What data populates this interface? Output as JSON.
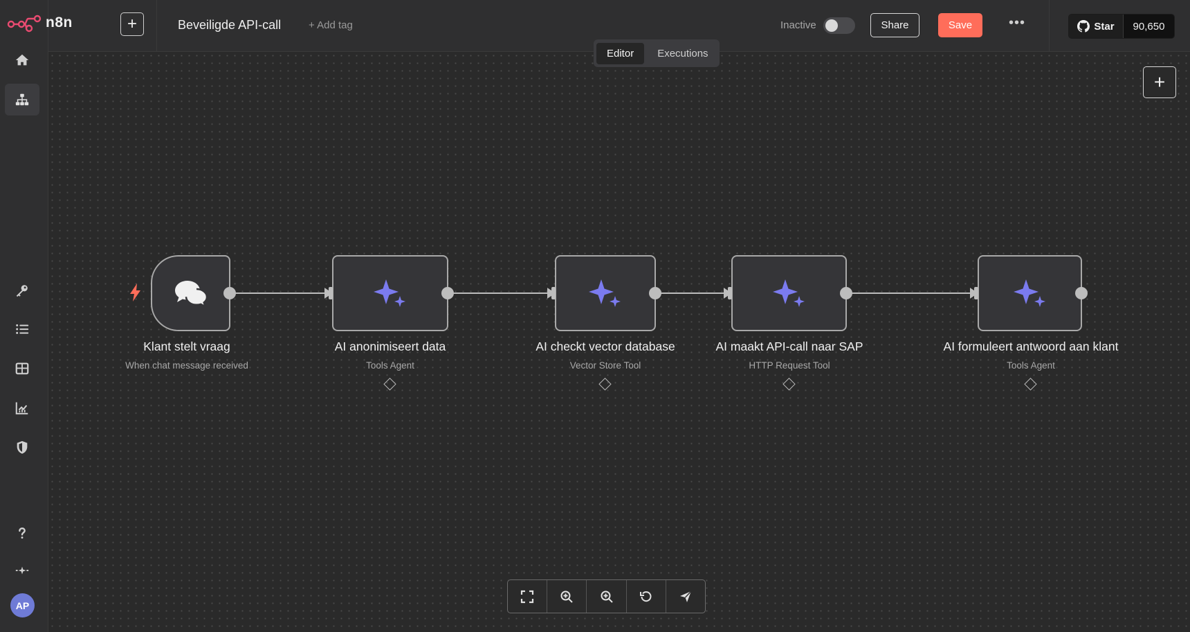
{
  "app": {
    "brand": "n8n",
    "brand_color": "#ea4b71"
  },
  "header": {
    "new_button_label": "+",
    "workflow_title": "Beveiligde API-call",
    "add_tag_label": "+ Add tag",
    "active_label": "Inactive",
    "active": false,
    "share_label": "Share",
    "save_label": "Save",
    "save_color": "#ff6d5a",
    "more_label": "•••",
    "github": {
      "star_label": "Star",
      "star_count": "90,650"
    }
  },
  "tabs": [
    {
      "label": "Editor",
      "active": true
    },
    {
      "label": "Executions",
      "active": false
    }
  ],
  "sidebar": {
    "items": [
      {
        "icon": "home-icon"
      },
      {
        "icon": "workflow-icon",
        "active": true
      },
      {
        "icon": "key-icon"
      },
      {
        "icon": "list-icon"
      },
      {
        "icon": "table-icon"
      },
      {
        "icon": "chart-icon"
      },
      {
        "icon": "shield-icon"
      },
      {
        "icon": "help-icon"
      },
      {
        "icon": "sparkle-icon"
      }
    ],
    "avatar_initials": "AP"
  },
  "canvas": {
    "add_node_label": "+",
    "nodes": [
      {
        "id": "trigger",
        "title": "Klant stelt vraag",
        "subtitle": "When chat message received",
        "icon": "chat-icon",
        "trigger_icon": "lightning-icon"
      },
      {
        "id": "anon",
        "title": "AI anonimiseert data",
        "subtitle": "Tools Agent",
        "icon": "sparkles-icon"
      },
      {
        "id": "vector",
        "title": "AI checkt vector database",
        "subtitle": "Vector Store Tool",
        "icon": "sparkles-icon"
      },
      {
        "id": "sap",
        "title": "AI maakt API-call naar SAP",
        "subtitle": "HTTP Request Tool",
        "icon": "sparkles-icon"
      },
      {
        "id": "answer",
        "title": "AI formuleert antwoord aan klant",
        "subtitle": "Tools Agent",
        "icon": "sparkles-icon"
      }
    ],
    "accent_color": "#7b7bef",
    "trigger_color": "#ff6d5a"
  },
  "toolbar": {
    "buttons": [
      {
        "icon": "fit-view-icon"
      },
      {
        "icon": "zoom-in-icon"
      },
      {
        "icon": "zoom-out-icon"
      },
      {
        "icon": "reset-icon"
      },
      {
        "icon": "send-icon"
      }
    ]
  }
}
